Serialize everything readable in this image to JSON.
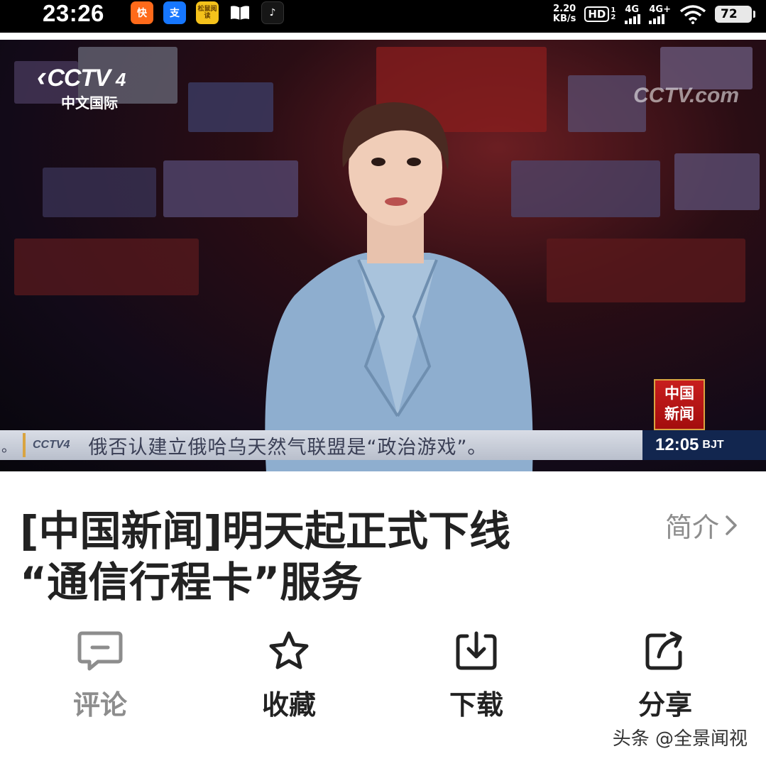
{
  "status_bar": {
    "time": "23:26",
    "apps": [
      {
        "name": "kuaishou",
        "glyph": "快"
      },
      {
        "name": "alipay",
        "glyph": "支"
      },
      {
        "name": "songshu-reader",
        "glyph": "松鼠阅读"
      },
      {
        "name": "book",
        "glyph": ""
      },
      {
        "name": "tiktok",
        "glyph": "♪"
      }
    ],
    "net_speed_value": "2.20",
    "net_speed_unit": "KB/s",
    "hd_label": "HD",
    "hd_sub": "1 2",
    "signal_1": "4G",
    "signal_2": "4G+",
    "battery": "72"
  },
  "video": {
    "channel_logo": "CCTV",
    "channel_number": "4",
    "channel_subtitle": "中文国际",
    "watermark": "CCTV.com",
    "news_badge": "中国新闻",
    "ticker_logo": "CCTV4",
    "ticker_text": "俄否认建立俄哈乌天然气联盟是“政治游戏”。",
    "ticker_time": "12:05",
    "ticker_zone": "BJT",
    "colors": {
      "ticker_bg": "#c7ccd7",
      "clock_bg": "#12264f",
      "badge_red": "#c81e1e"
    }
  },
  "content": {
    "title_line1": "[中国新闻]明天起正式下线",
    "title_line2": "“通信行程卡”服务",
    "intro_label": "简介",
    "actions": [
      {
        "id": "comment",
        "label": "评论",
        "icon": "comment-icon",
        "color": "#8d8d8d"
      },
      {
        "id": "favorite",
        "label": "收藏",
        "icon": "star-icon",
        "color": "#222222"
      },
      {
        "id": "download",
        "label": "下载",
        "icon": "download-icon",
        "color": "#222222"
      },
      {
        "id": "share",
        "label": "分享",
        "icon": "share-icon",
        "color": "#222222"
      }
    ],
    "credit": "头条 @全景闻视"
  }
}
